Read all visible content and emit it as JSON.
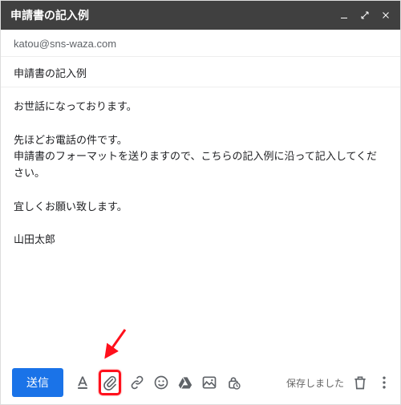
{
  "header": {
    "title": "申請書の記入例"
  },
  "to": "katou@sns-waza.com",
  "subject": "申請書の記入例",
  "body": "お世話になっております。\n\n先ほどお電話の件です。\n申請書のフォーマットを送りますので、こちらの記入例に沿って記入してください。\n\n宜しくお願い致します。\n\n山田太郎",
  "bottom": {
    "send_label": "送信",
    "saved_label": "保存しました"
  },
  "icons": {
    "formatting": "formatting-icon",
    "attach": "paperclip-icon",
    "link": "link-icon",
    "emoji": "emoji-icon",
    "drive": "drive-icon",
    "photo": "photo-icon",
    "lock": "confidential-icon",
    "trash": "trash-icon",
    "more": "more-icon",
    "minimize": "minimize-icon",
    "fullscreen": "fullscreen-icon",
    "close": "close-icon"
  },
  "annotation": {
    "highlight_color": "#ff101c"
  }
}
